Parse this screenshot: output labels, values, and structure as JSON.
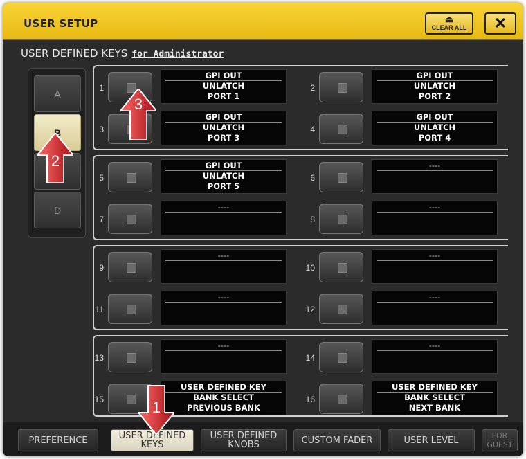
{
  "window": {
    "title": "USER SETUP",
    "clear_all_label": "CLEAR ALL",
    "close_label": "✕"
  },
  "section": {
    "title": "USER DEFINED KEYS",
    "for_label": "for Administrator"
  },
  "banks": [
    "A",
    "B",
    "",
    "D"
  ],
  "active_bank": "B",
  "keys": [
    {
      "num": "1",
      "l1": "GPI OUT",
      "l2": "UNLATCH",
      "l3": "PORT 1"
    },
    {
      "num": "2",
      "l1": "GPI OUT",
      "l2": "UNLATCH",
      "l3": "PORT 2"
    },
    {
      "num": "3",
      "l1": "GPI OUT",
      "l2": "UNLATCH",
      "l3": "PORT 3"
    },
    {
      "num": "4",
      "l1": "GPI OUT",
      "l2": "UNLATCH",
      "l3": "PORT 4"
    },
    {
      "num": "5",
      "l1": "GPI OUT",
      "l2": "UNLATCH",
      "l3": "PORT 5"
    },
    {
      "num": "6",
      "l1": "----",
      "l2": "",
      "l3": ""
    },
    {
      "num": "7",
      "l1": "----",
      "l2": "",
      "l3": ""
    },
    {
      "num": "8",
      "l1": "----",
      "l2": "",
      "l3": ""
    },
    {
      "num": "9",
      "l1": "----",
      "l2": "",
      "l3": ""
    },
    {
      "num": "10",
      "l1": "----",
      "l2": "",
      "l3": ""
    },
    {
      "num": "11",
      "l1": "----",
      "l2": "",
      "l3": ""
    },
    {
      "num": "12",
      "l1": "----",
      "l2": "",
      "l3": ""
    },
    {
      "num": "13",
      "l1": "----",
      "l2": "",
      "l3": ""
    },
    {
      "num": "14",
      "l1": "----",
      "l2": "",
      "l3": ""
    },
    {
      "num": "15",
      "l1": "USER DEFINED KEY",
      "l2": "BANK SELECT",
      "l3": "PREVIOUS BANK"
    },
    {
      "num": "16",
      "l1": "USER DEFINED KEY",
      "l2": "BANK SELECT",
      "l3": "NEXT BANK"
    }
  ],
  "tabs": [
    {
      "l1": "PREFERENCE",
      "l2": ""
    },
    {
      "l1": "USER DEFINED",
      "l2": "KEYS"
    },
    {
      "l1": "USER DEFINED",
      "l2": "KNOBS"
    },
    {
      "l1": "CUSTOM FADER",
      "l2": ""
    },
    {
      "l1": "USER LEVEL",
      "l2": ""
    },
    {
      "l1": "FOR",
      "l2": "GUEST"
    }
  ],
  "callouts": [
    "1",
    "2",
    "3"
  ],
  "colors": {
    "titlebar": "#f0c526",
    "arrow": "#d8232a",
    "active_bank": "#e8e0b0"
  }
}
